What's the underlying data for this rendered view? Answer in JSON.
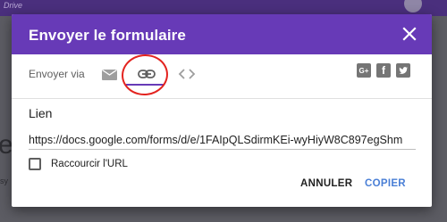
{
  "background": {
    "app_name": "Drive"
  },
  "dialog": {
    "title": "Envoyer le formulaire",
    "send_via_label": "Envoyer via",
    "tabs": [
      {
        "icon": "email-icon",
        "selected": false
      },
      {
        "icon": "link-icon",
        "selected": true
      },
      {
        "icon": "embed-code-icon",
        "selected": false
      }
    ],
    "social": [
      {
        "icon": "google-plus-icon",
        "glyph": "G+"
      },
      {
        "icon": "facebook-icon",
        "glyph": "f"
      },
      {
        "icon": "twitter-icon"
      }
    ],
    "link_label": "Lien",
    "url_value": "https://docs.google.com/forms/d/e/1FAIpQLSdirmKEi-wyHiyW8C897egShm",
    "shorten_label": "Raccourcir l'URL",
    "shorten_checked": false,
    "cancel_label": "ANNULER",
    "copy_label": "COPIER"
  },
  "colors": {
    "header": "#673ab7",
    "accent_button": "#4a7fd6",
    "annotation_circle": "#e3231f"
  }
}
